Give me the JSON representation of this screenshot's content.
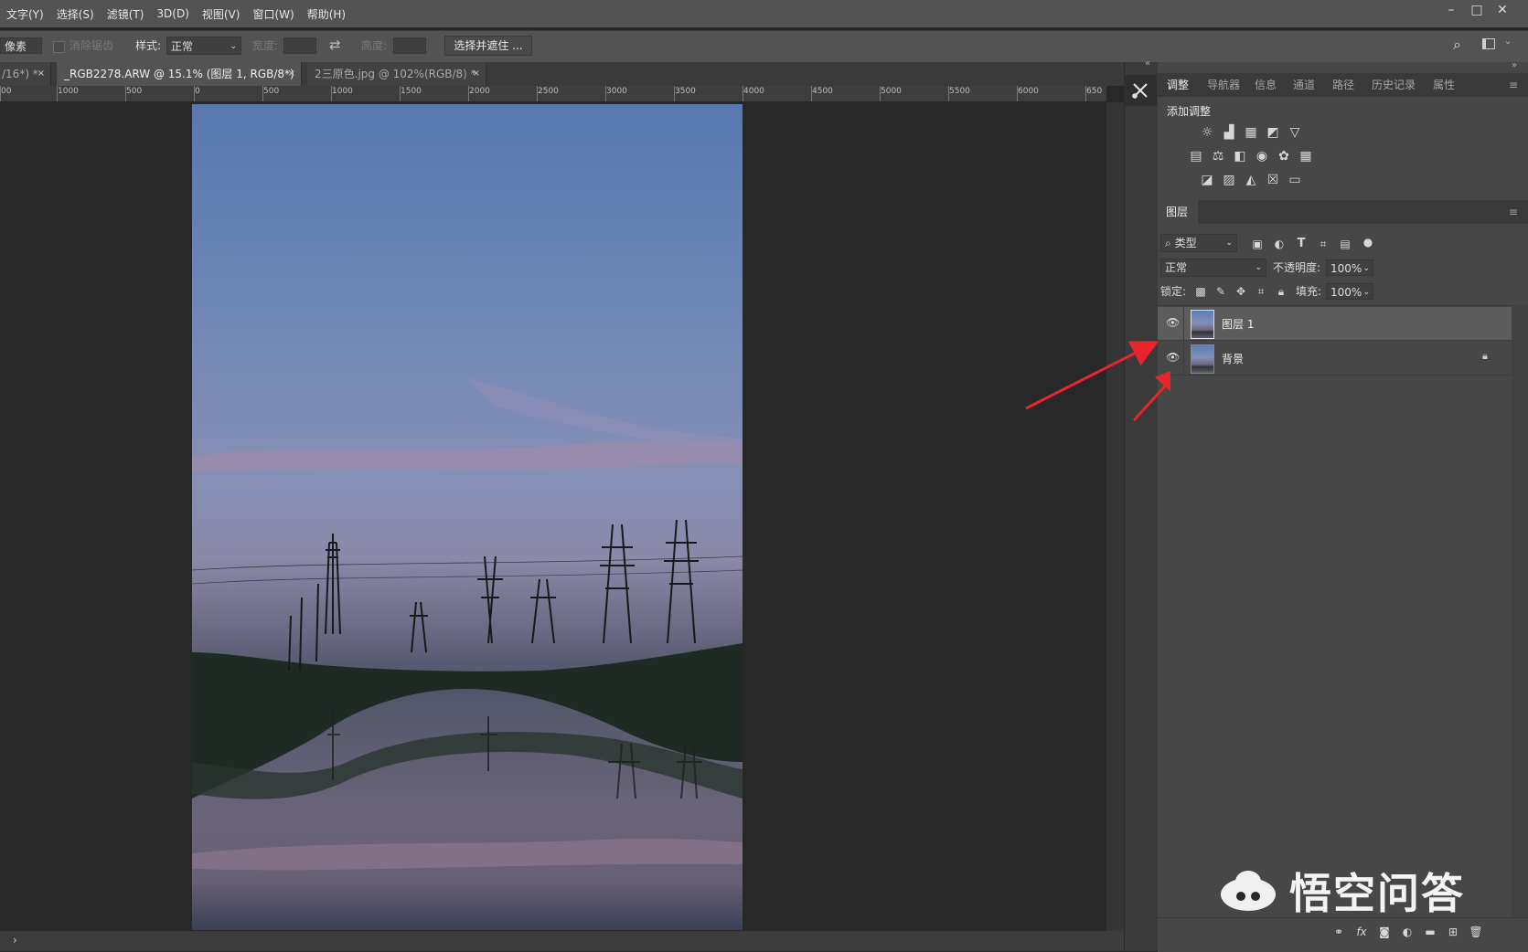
{
  "menu": {
    "items": [
      "文字(Y)",
      "选择(S)",
      "滤镜(T)",
      "3D(D)",
      "视图(V)",
      "窗口(W)",
      "帮助(H)"
    ]
  },
  "window_controls": {
    "minimize": "–",
    "maximize": "□",
    "close": "✕"
  },
  "options": {
    "feather_value": "像素",
    "antialias_label": "消除锯齿",
    "style_label": "样式:",
    "style_value": "正常",
    "width_label": "宽度:",
    "height_label": "高度:",
    "swap_icon": "⇄",
    "select_mask_button": "选择并遮住 ..."
  },
  "tabs": [
    {
      "label": "/16*) *",
      "close": "×"
    },
    {
      "label": "_RGB2278.ARW @ 15.1% (图层 1, RGB/8*) *",
      "close": "×"
    },
    {
      "label": "2三原色.jpg @ 102%(RGB/8) *",
      "close": "×"
    }
  ],
  "ruler": {
    "labels": [
      "00",
      "1000",
      "500",
      "0",
      "500",
      "1000",
      "1500",
      "2000",
      "2500",
      "3000",
      "3500",
      "4000",
      "4500",
      "5000",
      "5500",
      "6000",
      "650"
    ]
  },
  "panels": {
    "top_tabs": [
      "调整",
      "导航器",
      "信息",
      "通道",
      "路径",
      "历史记录",
      "属性"
    ],
    "add_adjustment": "添加调整",
    "layers_tab": "图层",
    "filter_kind": "类型",
    "blend_mode": "正常",
    "opacity_label": "不透明度:",
    "opacity_value": "100%",
    "lock_label": "锁定:",
    "fill_label": "填充:",
    "fill_value": "100%",
    "menu_icon": "≡"
  },
  "layers": [
    {
      "name": "图层 1",
      "visible": true,
      "locked": false,
      "selected": true
    },
    {
      "name": "背景",
      "visible": true,
      "locked": true,
      "selected": false
    }
  ],
  "footer_icons": [
    "link-icon",
    "fx-icon",
    "mask-icon",
    "adjustment-icon",
    "folder-icon",
    "new-layer-icon",
    "trash-icon"
  ],
  "footer_fx": "fx",
  "watermark": {
    "text": "悟空问答"
  },
  "colors": {
    "annotation_arrow": "#e8252a",
    "selected_layer": "#5c5c5c",
    "panel_bg": "#474747"
  }
}
